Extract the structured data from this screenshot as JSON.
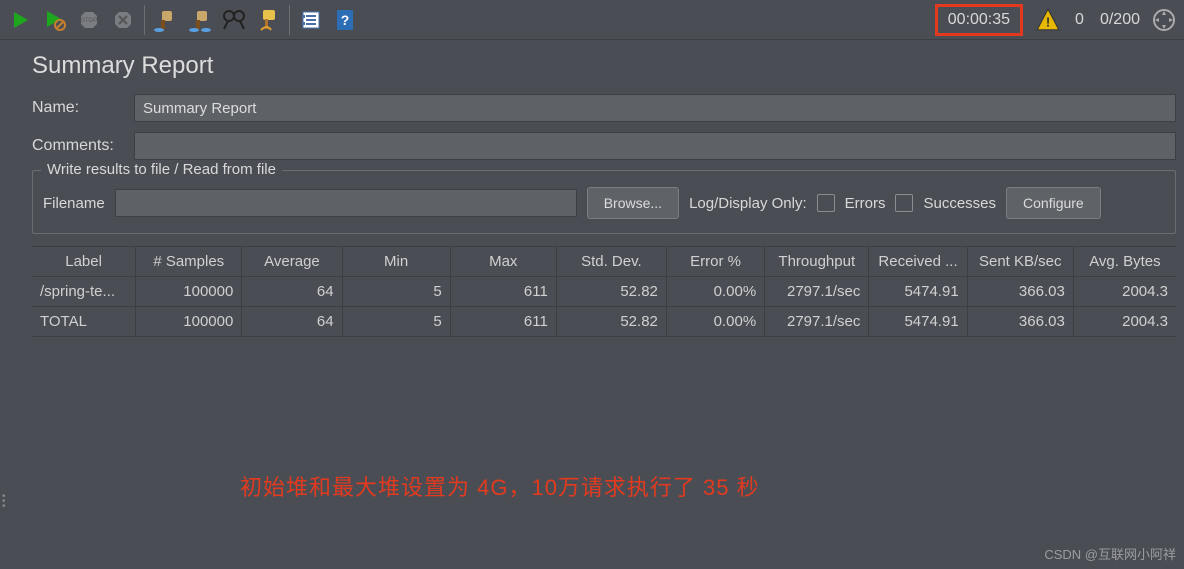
{
  "toolbar": {
    "timer": "00:00:35",
    "warn_count": "0",
    "thread_counter": "0/200"
  },
  "panel": {
    "title": "Summary Report",
    "name_label": "Name:",
    "name_value": "Summary Report",
    "comments_label": "Comments:",
    "comments_value": ""
  },
  "fileSection": {
    "legend": "Write results to file / Read from file",
    "filename_label": "Filename",
    "filename_value": "",
    "browse": "Browse...",
    "logdisplay": "Log/Display Only:",
    "errors": "Errors",
    "successes": "Successes",
    "configure": "Configure"
  },
  "table": {
    "headers": [
      "Label",
      "# Samples",
      "Average",
      "Min",
      "Max",
      "Std. Dev.",
      "Error %",
      "Throughput",
      "Received ...",
      "Sent KB/sec",
      "Avg. Bytes"
    ],
    "rows": [
      {
        "label": "/spring-te...",
        "samples": "100000",
        "avg": "64",
        "min": "5",
        "max": "611",
        "std": "52.82",
        "err": "0.00%",
        "thr": "2797.1/sec",
        "recv": "5474.91",
        "sent": "366.03",
        "bytes": "2004.3"
      },
      {
        "label": "TOTAL",
        "samples": "100000",
        "avg": "64",
        "min": "5",
        "max": "611",
        "std": "52.82",
        "err": "0.00%",
        "thr": "2797.1/sec",
        "recv": "5474.91",
        "sent": "366.03",
        "bytes": "2004.3"
      }
    ]
  },
  "annotation": "初始堆和最大堆设置为 4G，10万请求执行了 35 秒",
  "watermark": "CSDN @互联网小阿祥"
}
